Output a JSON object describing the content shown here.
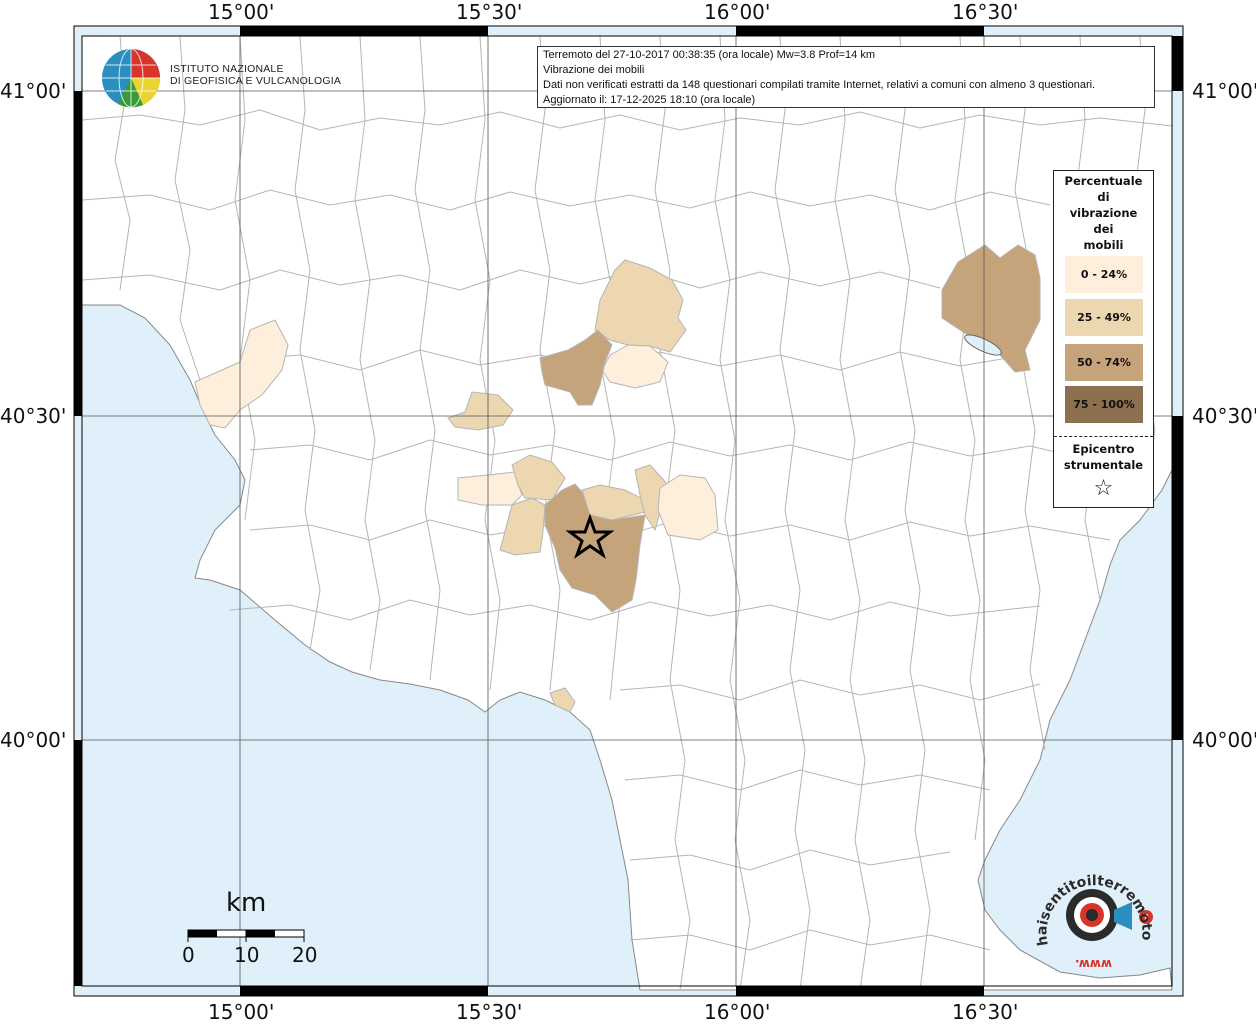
{
  "header": {
    "line1": "Terremoto del 27-10-2017 00:38:35 (ora locale) Mw=3.8 Prof=14 km",
    "line2": "Vibrazione dei mobili",
    "line3": "Dati non verificati estratti da 148 questionari compilati tramite Internet, relativi a comuni con almeno 3 questionari.",
    "line4": "Aggiornato il: 17-12-2025 18:10 (ora locale)"
  },
  "logo": {
    "line1": "ISTITUTO NAZIONALE",
    "line2": "DI GEOFISICA E VULCANOLOGIA"
  },
  "legend": {
    "title_lines": [
      "Percentuale",
      "di",
      "vibrazione",
      "dei",
      "mobili"
    ],
    "classes": [
      {
        "label": "0 - 24%",
        "color": "#fdefdc"
      },
      {
        "label": "25 - 49%",
        "color": "#ecd7b0"
      },
      {
        "label": "50 - 74%",
        "color": "#c6a47b"
      },
      {
        "label": "75 - 100%",
        "color": "#8c7050"
      }
    ],
    "epicenter_label_1": "Epicentro",
    "epicenter_label_2": "strumentale",
    "epicenter_symbol": "☆"
  },
  "axes": {
    "top_bottom_labels": [
      "15°00'",
      "15°30'",
      "16°00'",
      "16°30'"
    ],
    "left_right_labels": [
      "41°00'",
      "40°30'",
      "40°00'"
    ]
  },
  "scale_bar": {
    "unit": "km",
    "ticks": [
      "0",
      "10",
      "20"
    ]
  },
  "watermark": {
    "text": "haisentitoilterremoto.it",
    "prefix": "www."
  },
  "colors": {
    "sea": "#dff0fb",
    "land": "#ffffff",
    "border": "#b5b5b5",
    "epicenter_region": "#c6a47b"
  }
}
